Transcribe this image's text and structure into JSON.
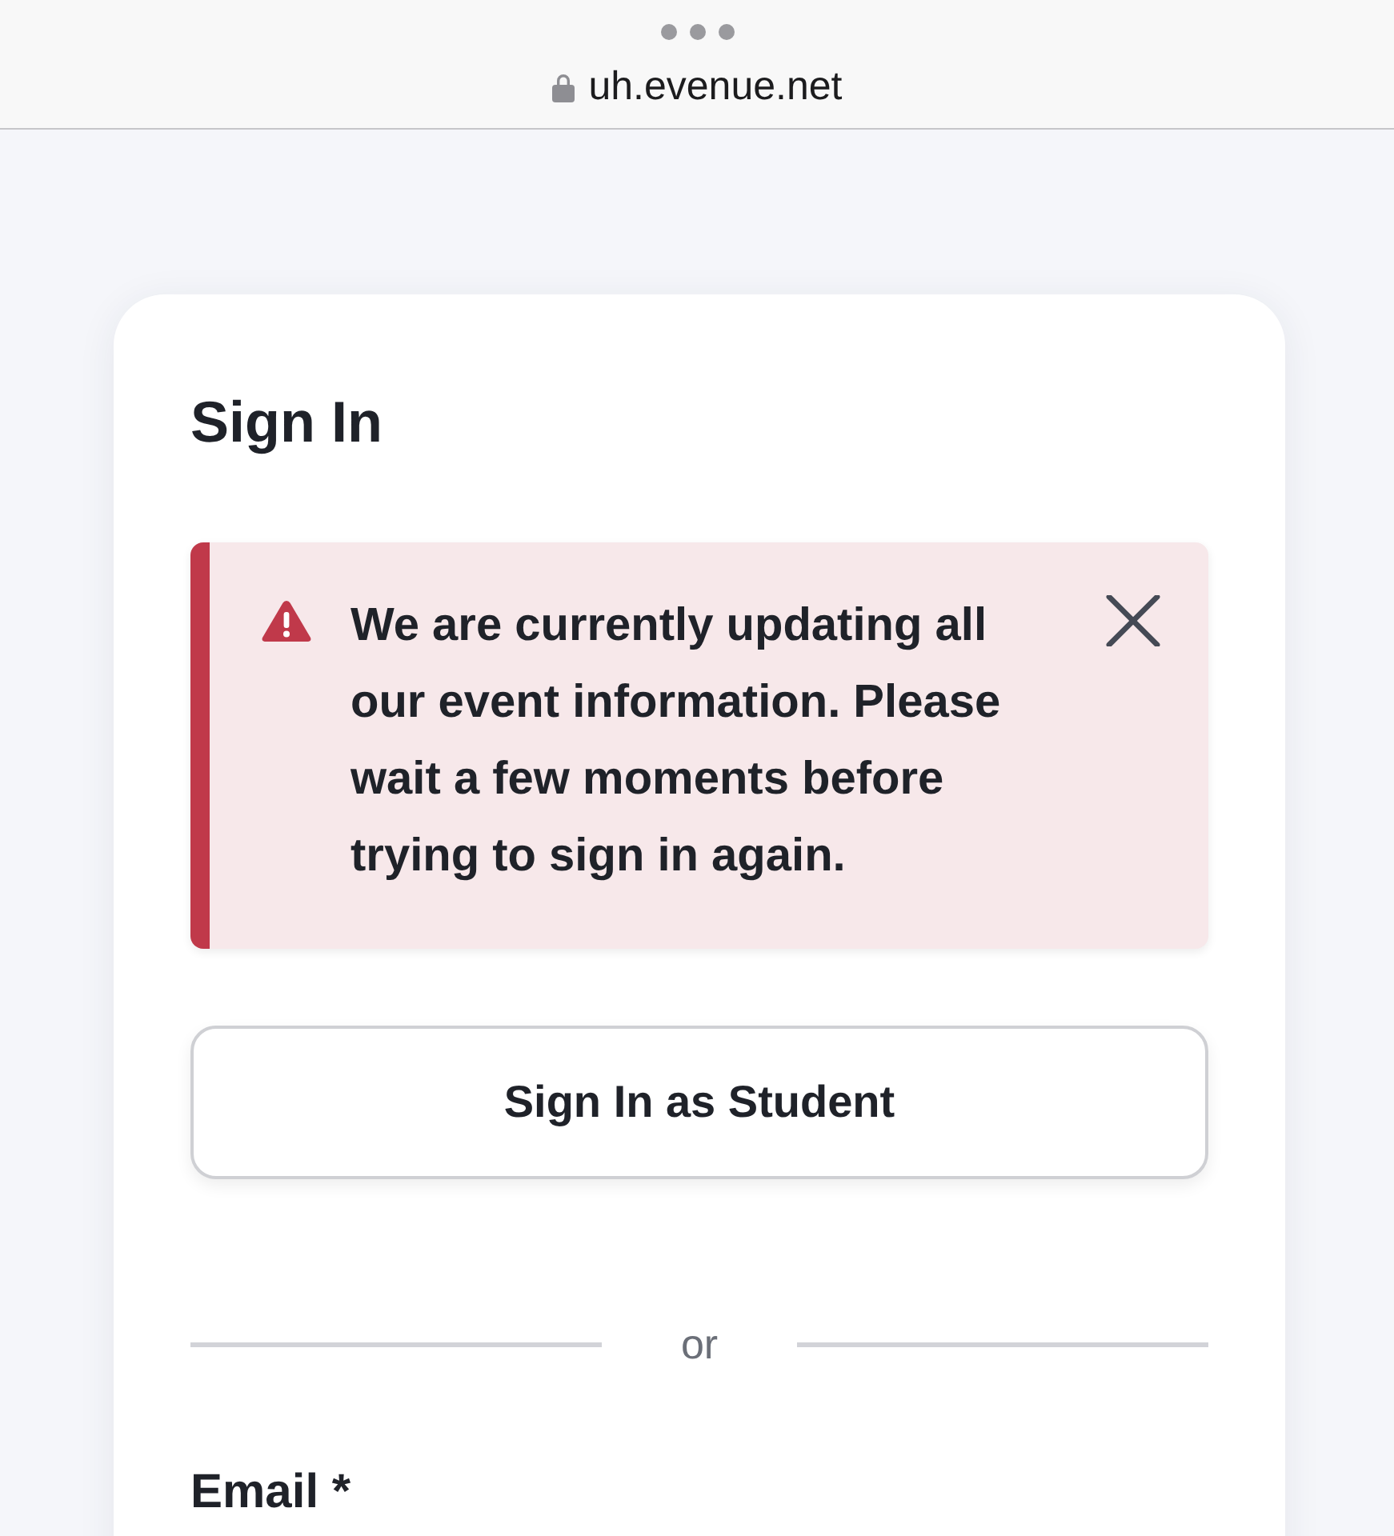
{
  "browser": {
    "url": "uh.evenue.net",
    "secure": true
  },
  "sign_in": {
    "title": "Sign In",
    "alert": {
      "kind": "error",
      "message": "We are currently updating all our event information. Please wait a few moments before trying to sign in again.",
      "dismissible": true
    },
    "student_button": "Sign In as Student",
    "divider": "or",
    "email_label": "Email *"
  }
}
